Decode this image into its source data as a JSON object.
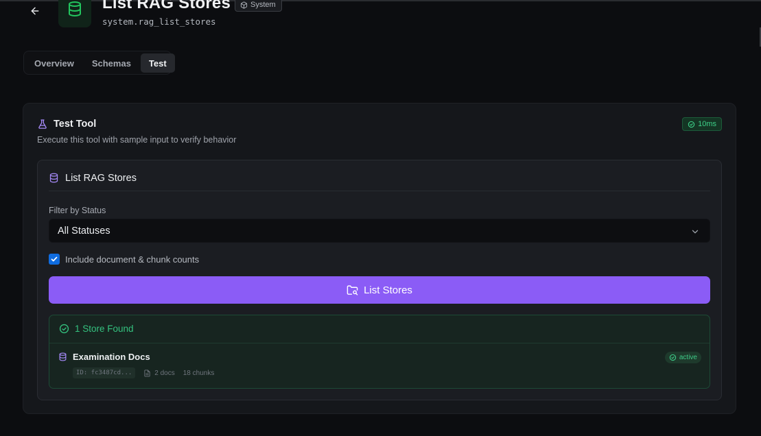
{
  "header": {
    "title": "List RAG Stores",
    "system_chip": "System",
    "subtitle": "system.rag_list_stores"
  },
  "tabs": [
    {
      "label": "Overview",
      "active": false
    },
    {
      "label": "Schemas",
      "active": false
    },
    {
      "label": "Test",
      "active": true
    }
  ],
  "card": {
    "title": "Test Tool",
    "description": "Execute this tool with sample input to verify behavior",
    "timing": "10ms",
    "tool": {
      "title": "List RAG Stores",
      "filter_label": "Filter by Status",
      "filter_value": "All Statuses",
      "include_counts_label": "Include document & chunk counts",
      "include_counts_checked": true,
      "submit_label": "List Stores"
    },
    "results": {
      "summary": "1 Store Found",
      "stores": [
        {
          "name": "Examination Docs",
          "status": "active",
          "id": "ID: fc3487cd...",
          "docs": "2 docs",
          "chunks": "18 chunks"
        }
      ]
    }
  },
  "colors": {
    "accent": "#8b5cf6",
    "success": "#34c27f",
    "brand_green": "#22c55e",
    "checkbox": "#0f6ce0"
  },
  "icons": {
    "back": "arrow-left-icon",
    "database": "database-icon",
    "system": "box-icon",
    "flask": "flask-icon",
    "check_circle": "check-circle-icon",
    "chevron": "chevron-down-icon",
    "folder_search": "folder-search-icon",
    "file": "file-icon"
  }
}
